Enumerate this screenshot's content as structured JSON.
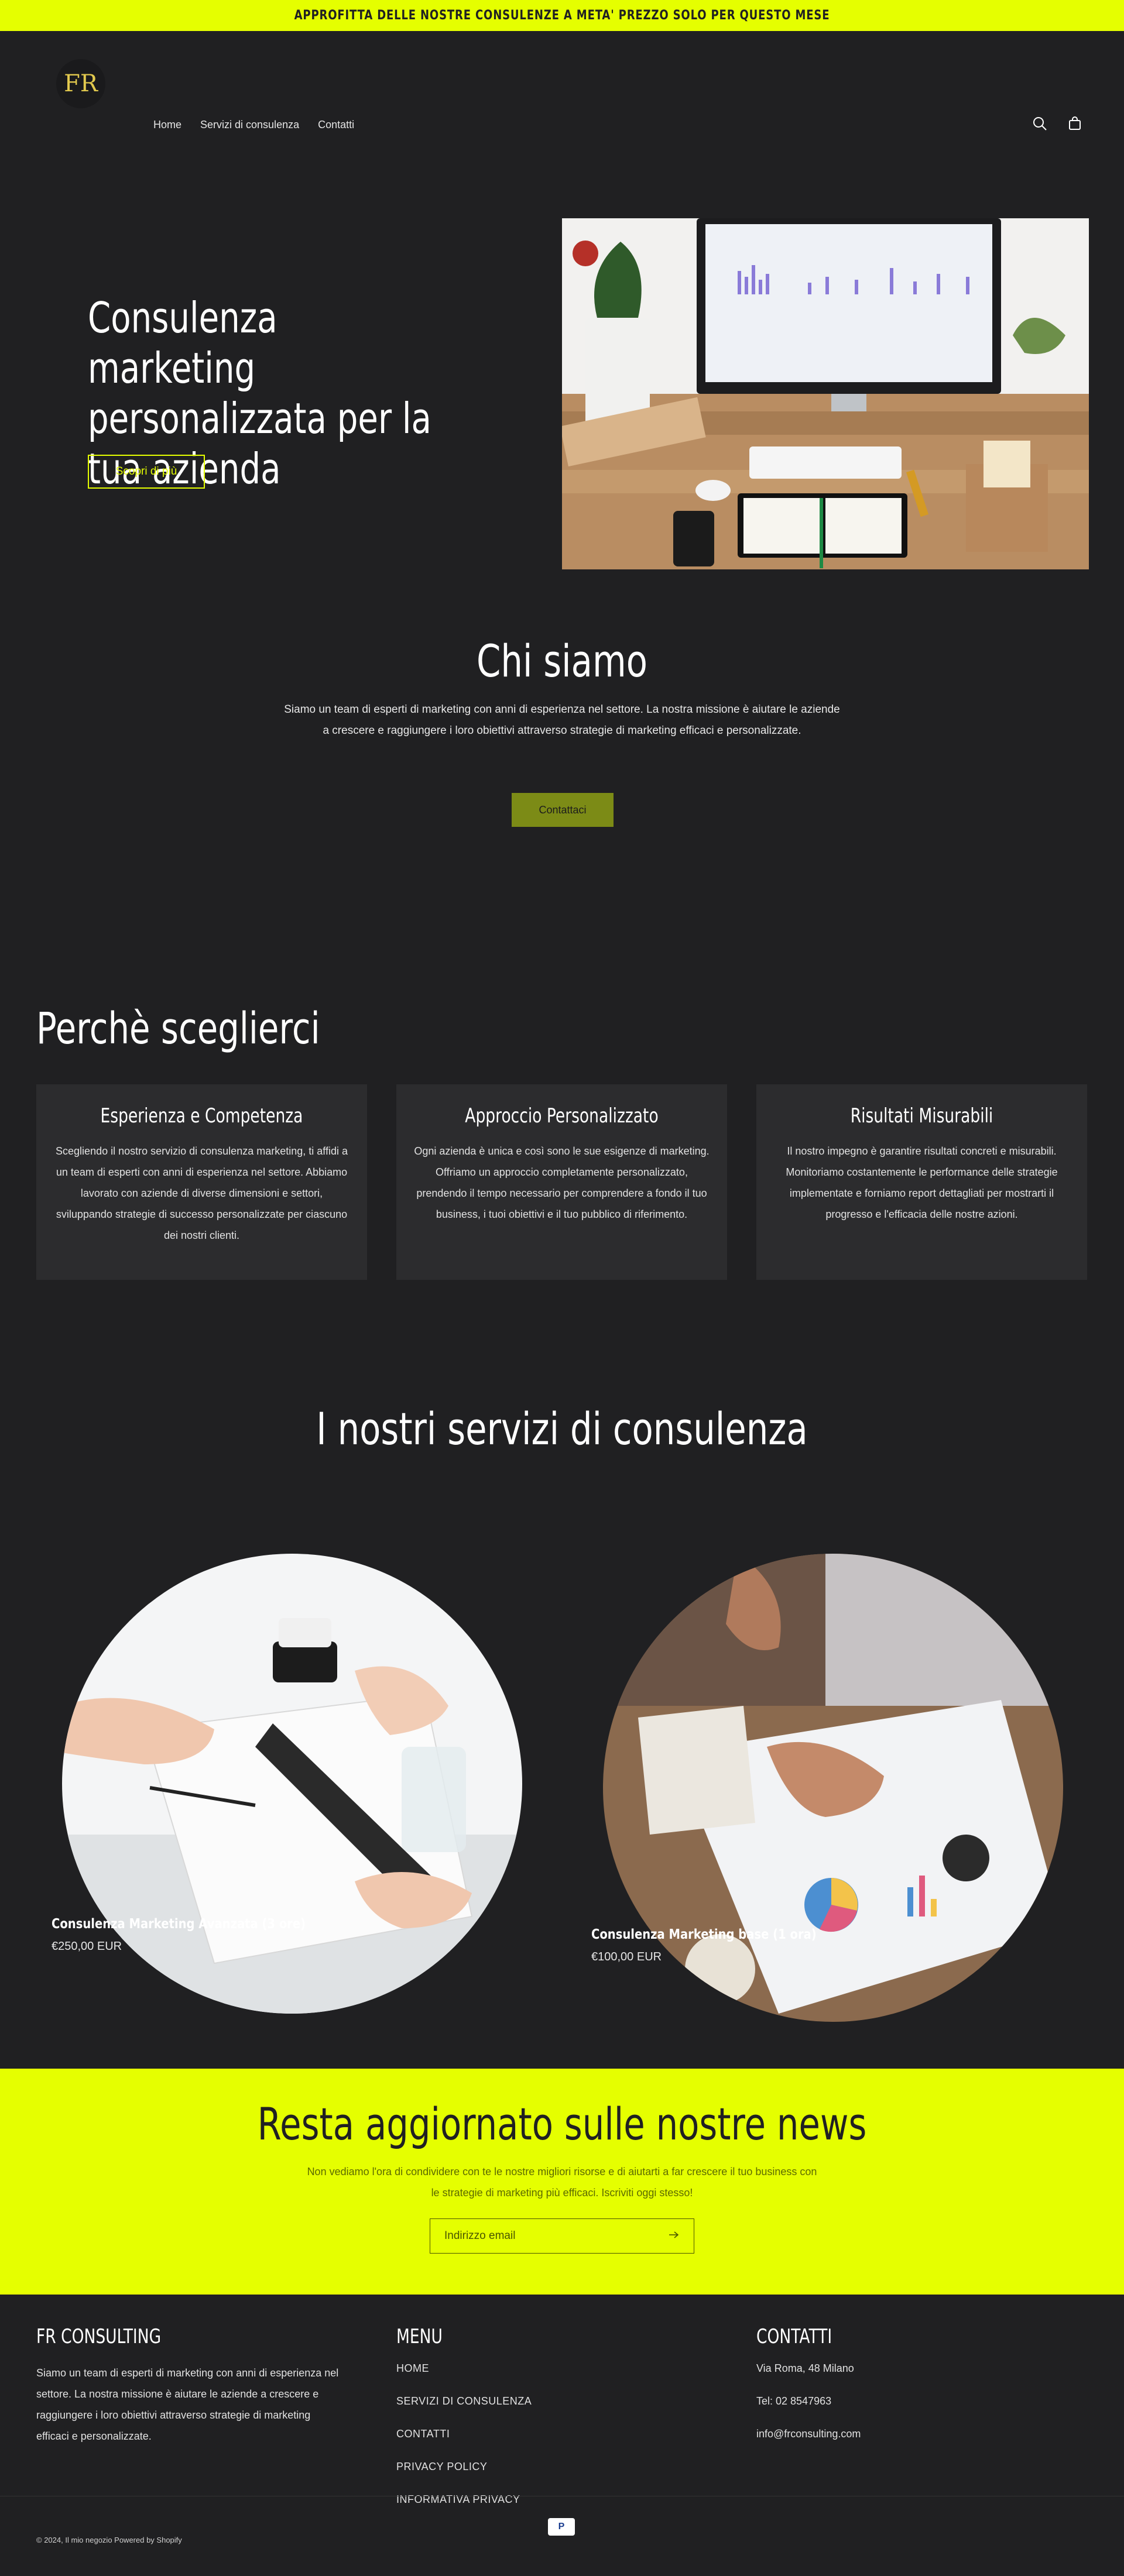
{
  "announcement": "APPROFITTA DELLE NOSTRE CONSULENZE A META' PREZZO SOLO PER QUESTO MESE",
  "header": {
    "logo_text": "FR",
    "nav": [
      "Home",
      "Servizi di consulenza",
      "Contatti"
    ],
    "icons": [
      "search-icon",
      "cart-icon"
    ]
  },
  "hero": {
    "title": "Consulenza marketing personalizzata per la tua azienda",
    "button": "Scopri di più"
  },
  "about": {
    "title": "Chi siamo",
    "text": "Siamo un team di esperti di marketing con anni di esperienza nel settore. La nostra missione è aiutare le aziende a crescere e raggiungere i loro obiettivi attraverso strategie di marketing efficaci e personalizzate.",
    "button": "Contattaci"
  },
  "why": {
    "title": "Perchè sceglierci",
    "cards": [
      {
        "title": "Esperienza e Competenza",
        "text": "Scegliendo il nostro servizio di consulenza marketing, ti affidi a un team di esperti con anni di esperienza nel settore. Abbiamo lavorato con aziende di diverse dimensioni e settori, sviluppando strategie di successo personalizzate per ciascuno dei nostri clienti."
      },
      {
        "title": "Approccio Personalizzato",
        "text": "Ogni azienda è unica e così sono le sue esigenze di marketing. Offriamo un approccio completamente personalizzato, prendendo il tempo necessario per comprendere a fondo il tuo business, i tuoi obiettivi e il tuo pubblico di riferimento."
      },
      {
        "title": "Risultati Misurabili",
        "text": "Il nostro impegno è garantire risultati concreti e misurabili. Monitoriamo costantemente le performance delle strategie implementate e forniamo report dettagliati per mostrarti il progresso e l'efficacia delle nostre azioni."
      }
    ]
  },
  "services": {
    "title": "I nostri servizi di consulenza",
    "products": [
      {
        "name": "Consulenza Marketing Avanzata (3 ore)",
        "price": "€250,00 EUR"
      },
      {
        "name": "Consulenza Marketing base (1 ora)",
        "price": "€100,00 EUR"
      }
    ]
  },
  "newsletter": {
    "title": "Resta aggiornato sulle nostre news",
    "text": "Non vediamo l'ora di condividere con te le nostre migliori risorse e di aiutarti a far crescere il tuo business con le strategie di marketing più efficaci. Iscriviti oggi stesso!",
    "placeholder": "Indirizzo email"
  },
  "footer": {
    "brand_title": "FR CONSULTING",
    "brand_text": "Siamo un team di esperti di marketing con anni di esperienza nel settore. La nostra missione è aiutare le aziende a crescere e raggiungere i loro obiettivi attraverso strategie di marketing efficaci e personalizzate.",
    "menu_title": "MENU",
    "menu": [
      "HOME",
      "SERVIZI DI CONSULENZA",
      "CONTATTI",
      "PRIVACY POLICY",
      "INFORMATIVA PRIVACY"
    ],
    "contacts_title": "CONTATTI",
    "contacts": [
      "Via Roma, 48 Milano",
      "Tel: 02 8547963",
      "info@frconsulting.com"
    ],
    "payment": "P",
    "copyright": "© 2024, Il mio negozio Powered by Shopify"
  }
}
